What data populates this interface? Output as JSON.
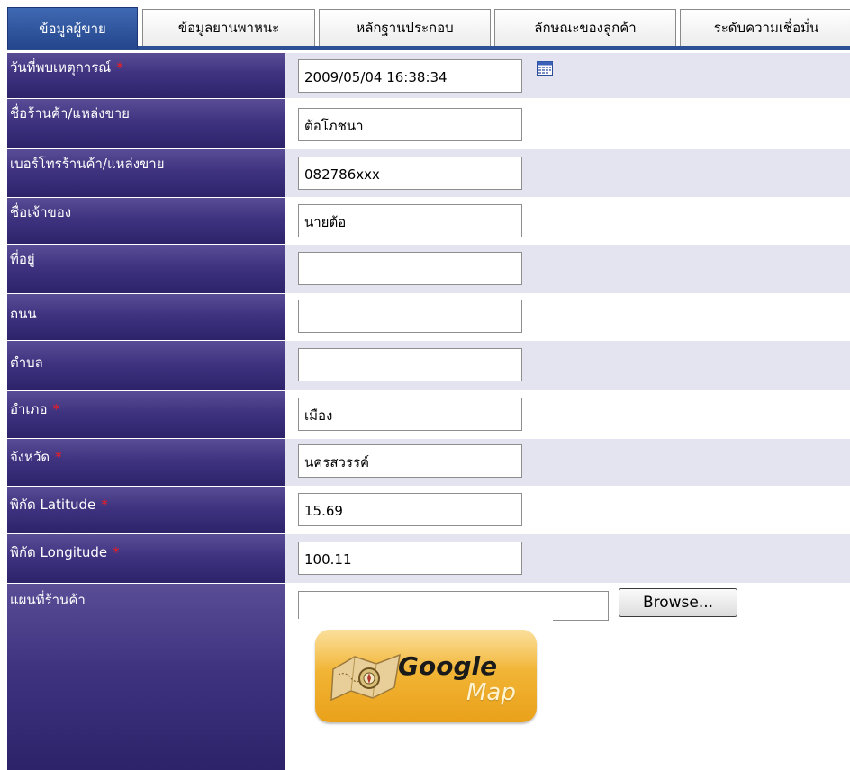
{
  "tabs": [
    {
      "label": "ข้อมูลผู้ขาย",
      "active": true
    },
    {
      "label": "ข้อมูลยานพาหนะ",
      "active": false
    },
    {
      "label": "หลักฐานประกอบ",
      "active": false
    },
    {
      "label": "ลักษณะของลูกค้า",
      "active": false
    },
    {
      "label": "ระดับความเชื่อมั่น",
      "active": false
    }
  ],
  "form": {
    "incident_date": {
      "label": "วันที่พบเหตุการณ์",
      "required_mark": "*",
      "value": "2009/05/04 16:38:34",
      "icon": "calendar-icon"
    },
    "shop_name": {
      "label": "ชื่อร้านค้า/แหล่งขาย",
      "value": "ต้อโภชนา"
    },
    "shop_phone": {
      "label": "เบอร์โทรร้านค้า/แหล่งขาย",
      "value": "082786xxx"
    },
    "owner_name": {
      "label": "ชื่อเจ้าของ",
      "value": "นายต้อ"
    },
    "address": {
      "label": "ที่อยู่",
      "value": ""
    },
    "road": {
      "label": "ถนน",
      "value": ""
    },
    "subdistrict": {
      "label": "ตำบล",
      "value": ""
    },
    "district": {
      "label": "อำเภอ",
      "required_mark": "*",
      "value": "เมือง"
    },
    "province": {
      "label": "จังหวัด",
      "required_mark": "*",
      "value": "นครสวรรค์"
    },
    "latitude": {
      "label": "พิกัด Latitude",
      "required_mark": "*",
      "value": "15.69"
    },
    "longitude": {
      "label": "พิกัด Longitude",
      "required_mark": "*",
      "value": "100.11"
    },
    "shop_map": {
      "label": "แผนที่ร้านค้า",
      "file_value": "",
      "browse_label": "Browse...",
      "map_button": {
        "word1": "Google",
        "word2": "Map"
      }
    }
  },
  "colors": {
    "label_bg": "#3f3380",
    "tab_active": "#2d4f94",
    "required": "#ff1a1a",
    "alt_row": "#e4e4f1"
  }
}
